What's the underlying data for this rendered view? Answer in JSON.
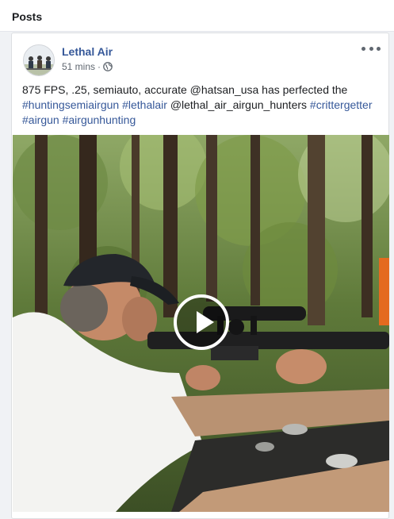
{
  "section": {
    "title": "Posts"
  },
  "post": {
    "author": "Lethal Air",
    "time": "51 mins",
    "separator": "·",
    "privacy_icon": "globe-icon",
    "more_icon": "more-horizontal-icon",
    "text_plain_1": "875 FPS, .25, semiauto, accurate @hatsan_usa has perfected the",
    "hashtag_1": "#huntingsemiairgun",
    "hashtag_2": "#lethalair",
    "text_plain_2": "@lethal_air_airgun_hunters",
    "hashtag_3": "#crittergetter",
    "hashtag_4": "#airgun",
    "hashtag_5": "#airgunhunting",
    "media": {
      "type": "video",
      "play_icon": "play-icon"
    }
  },
  "colors": {
    "link": "#365899",
    "text": "#1c1e21",
    "meta": "#606770"
  }
}
